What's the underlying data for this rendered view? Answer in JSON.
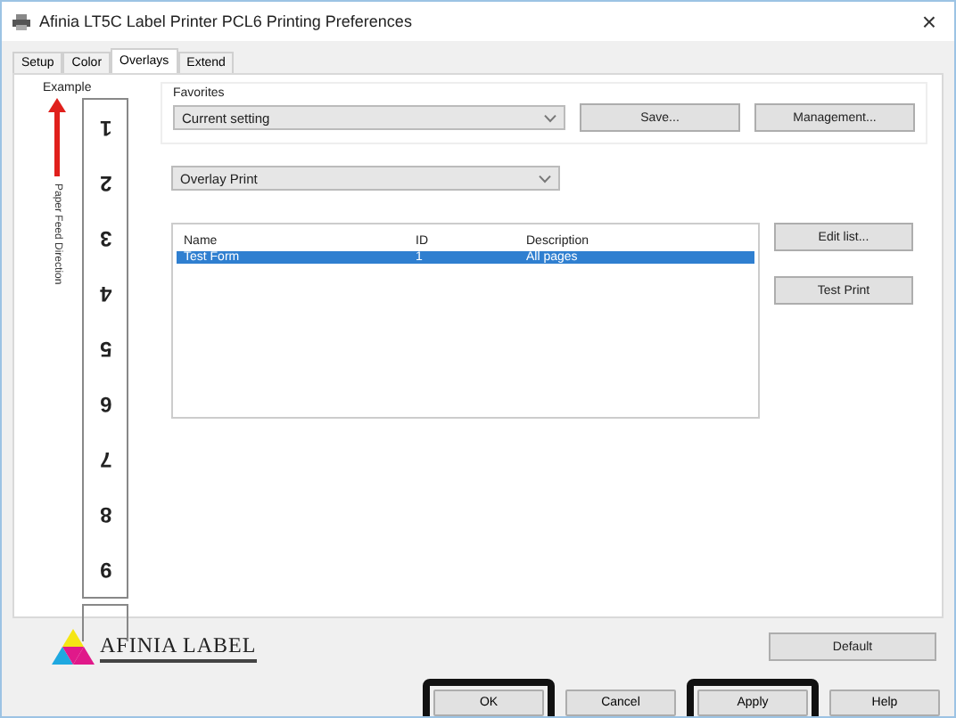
{
  "window": {
    "title": "Afinia LT5C Label Printer PCL6 Printing Preferences",
    "close": "×"
  },
  "tabs": [
    {
      "label": "Setup",
      "selected": false
    },
    {
      "label": "Color",
      "selected": false
    },
    {
      "label": "Overlays",
      "selected": true
    },
    {
      "label": "Extend",
      "selected": false
    }
  ],
  "example": {
    "title": "Example",
    "direction_label": "Paper Feed Direction",
    "labels": [
      "1",
      "2",
      "3",
      "4",
      "5",
      "6",
      "7",
      "8",
      "9"
    ]
  },
  "favorites": {
    "title": "Favorites",
    "value": "Current setting",
    "buttons": [
      "Save...",
      "Management..."
    ]
  },
  "overlay": {
    "value": "Overlay Print"
  },
  "table": {
    "columns": [
      "Name",
      "ID",
      "Description"
    ],
    "rows": [
      {
        "cells": [
          "Test Form",
          "1",
          "All pages"
        ],
        "selected": true
      }
    ]
  },
  "side_buttons": [
    "Edit list...",
    "Test Print"
  ],
  "logo": {
    "text": "AFINIA LABEL"
  },
  "default_button": "Default",
  "footer_buttons": [
    {
      "label": "OK",
      "highlighted": true
    },
    {
      "label": "Cancel",
      "highlighted": false
    },
    {
      "label": "Apply",
      "highlighted": true
    },
    {
      "label": "Help",
      "highlighted": false
    }
  ]
}
